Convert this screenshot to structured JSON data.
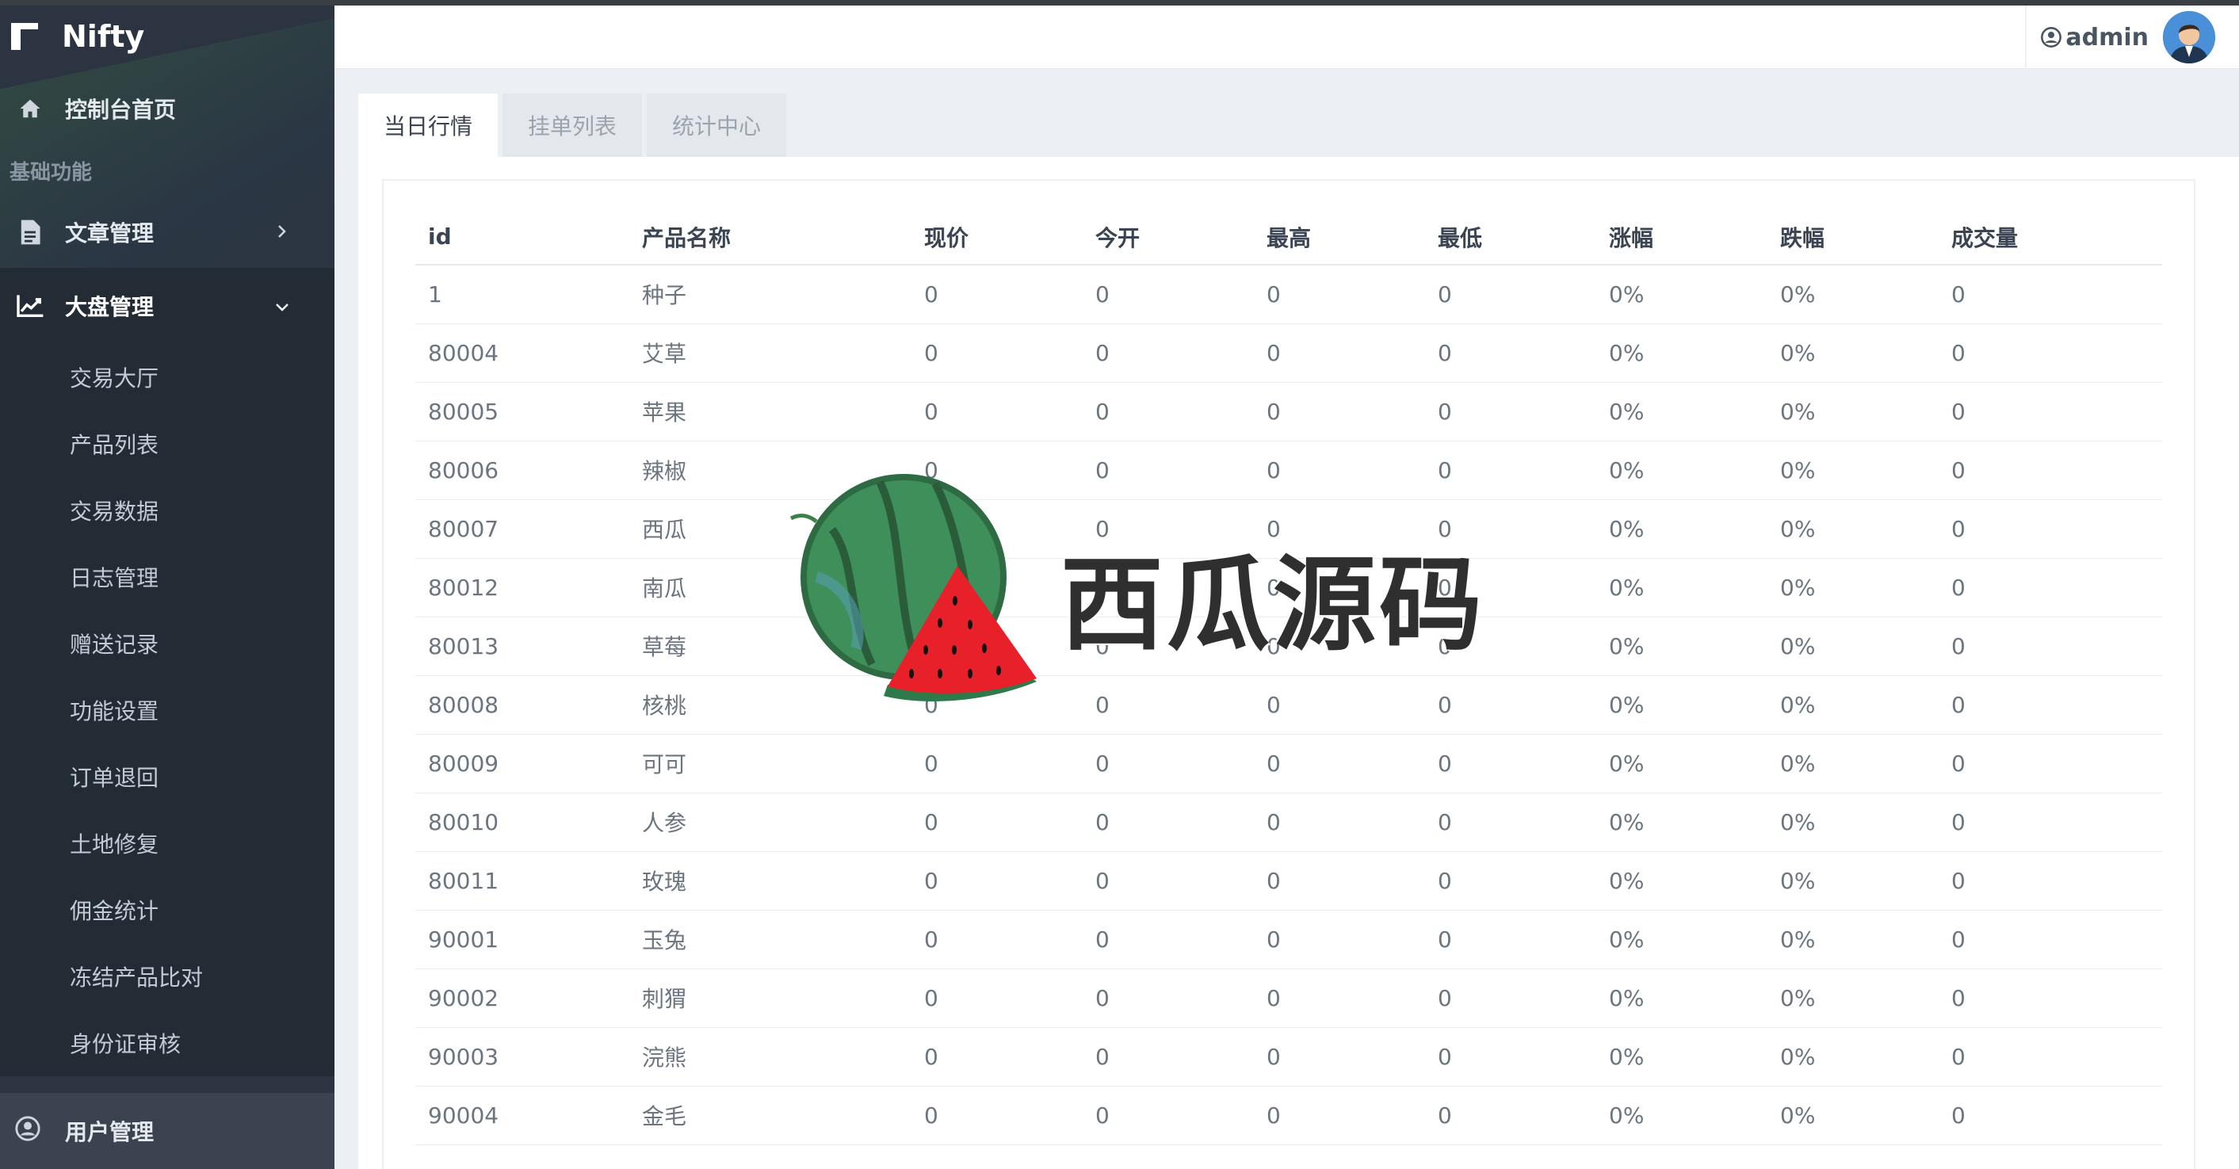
{
  "brand": {
    "name": "Nifty"
  },
  "sidebar": {
    "home_label": "控制台首页",
    "section_label": "基础功能",
    "articles_label": "文章管理",
    "market_label": "大盘管理",
    "submenu": [
      "交易大厅",
      "产品列表",
      "交易数据",
      "日志管理",
      "赠送记录",
      "功能设置",
      "订单退回",
      "土地修复",
      "佣金统计",
      "冻结产品比对",
      "身份证审核"
    ],
    "users_label": "用户管理"
  },
  "header": {
    "username": "admin"
  },
  "tabs": [
    "当日行情",
    "挂单列表",
    "统计中心"
  ],
  "table": {
    "columns": [
      "id",
      "产品名称",
      "现价",
      "今开",
      "最高",
      "最低",
      "涨幅",
      "跌幅",
      "成交量"
    ],
    "rows": [
      [
        "1",
        "种子",
        "0",
        "0",
        "0",
        "0",
        "0%",
        "0%",
        "0"
      ],
      [
        "80004",
        "艾草",
        "0",
        "0",
        "0",
        "0",
        "0%",
        "0%",
        "0"
      ],
      [
        "80005",
        "苹果",
        "0",
        "0",
        "0",
        "0",
        "0%",
        "0%",
        "0"
      ],
      [
        "80006",
        "辣椒",
        "0",
        "0",
        "0",
        "0",
        "0%",
        "0%",
        "0"
      ],
      [
        "80007",
        "西瓜",
        "0",
        "0",
        "0",
        "0",
        "0%",
        "0%",
        "0"
      ],
      [
        "80012",
        "南瓜",
        "0",
        "0",
        "0",
        "0",
        "0%",
        "0%",
        "0"
      ],
      [
        "80013",
        "草莓",
        "0",
        "0",
        "0",
        "0",
        "0%",
        "0%",
        "0"
      ],
      [
        "80008",
        "核桃",
        "0",
        "0",
        "0",
        "0",
        "0%",
        "0%",
        "0"
      ],
      [
        "80009",
        "可可",
        "0",
        "0",
        "0",
        "0",
        "0%",
        "0%",
        "0"
      ],
      [
        "80010",
        "人参",
        "0",
        "0",
        "0",
        "0",
        "0%",
        "0%",
        "0"
      ],
      [
        "80011",
        "玫瑰",
        "0",
        "0",
        "0",
        "0",
        "0%",
        "0%",
        "0"
      ],
      [
        "90001",
        "玉兔",
        "0",
        "0",
        "0",
        "0",
        "0%",
        "0%",
        "0"
      ],
      [
        "90002",
        "刺猬",
        "0",
        "0",
        "0",
        "0",
        "0%",
        "0%",
        "0"
      ],
      [
        "90003",
        "浣熊",
        "0",
        "0",
        "0",
        "0",
        "0%",
        "0%",
        "0"
      ],
      [
        "90004",
        "金毛",
        "0",
        "0",
        "0",
        "0",
        "0%",
        "0%",
        "0"
      ]
    ]
  },
  "watermark": {
    "text": "西瓜源码"
  },
  "icons": {
    "brand": "nifty-logo-icon",
    "home": "home-icon",
    "articles": "document-icon",
    "market": "line-chart-icon",
    "users": "user-circle-icon",
    "chevron_right": "chevron-right-icon",
    "chevron_down": "chevron-down-icon",
    "avatar": "avatar",
    "watermark": "watermelon-icon"
  },
  "colors": {
    "sidebar_bg": "#2b3440",
    "sidebar_active_bg": "#232b35",
    "page_bg": "#ecf0f5",
    "text_dark": "#3a4452",
    "text_muted": "#6b7580"
  }
}
